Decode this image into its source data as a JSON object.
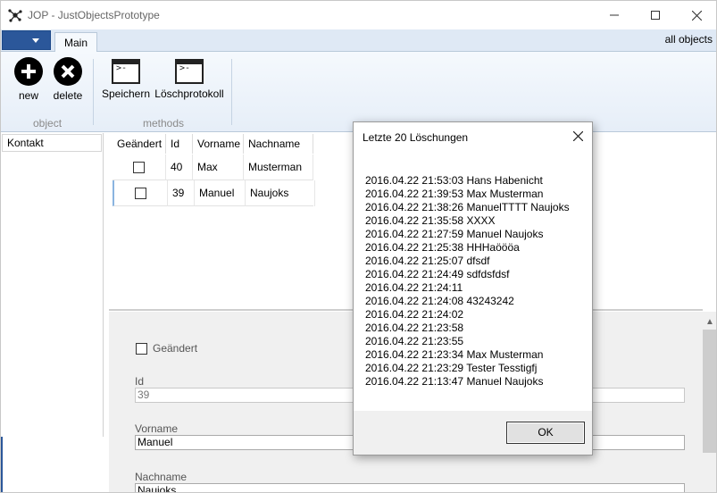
{
  "window": {
    "title": "JOP - JustObjectsPrototype"
  },
  "ribbon": {
    "tab_main": "Main",
    "all_objects": "all objects",
    "buttons": {
      "new": "new",
      "delete": "delete",
      "speichern": "Speichern",
      "loeschprotokoll": "Löschprotokoll"
    },
    "groups": {
      "object": "object",
      "methods": "methods"
    }
  },
  "nav": {
    "items": [
      {
        "label": "Kontakt"
      }
    ]
  },
  "grid": {
    "columns": [
      "Geändert",
      "Id",
      "Vorname",
      "Nachname"
    ],
    "rows": [
      {
        "changed": false,
        "id": "40",
        "vorname": "Max",
        "nachname": "Musterman"
      },
      {
        "changed": false,
        "id": "39",
        "vorname": "Manuel",
        "nachname": "Naujoks"
      }
    ]
  },
  "detail": {
    "changed_label": "Geändert",
    "id_label": "Id",
    "id_value": "39",
    "vorname_label": "Vorname",
    "vorname_value": "Manuel",
    "nachname_label": "Nachname",
    "nachname_value": "Naujoks"
  },
  "dialog": {
    "title": "Letzte 20 Löschungen",
    "ok": "OK",
    "entries": [
      "2016.04.22 21:53:03 Hans Habenicht",
      "2016.04.22 21:39:53 Max Musterman",
      "2016.04.22 21:38:26 ManuelTTTT Naujoks",
      "2016.04.22 21:35:58 XXXX",
      "2016.04.22 21:27:59 Manuel Naujoks",
      "2016.04.22 21:25:38 HHHaöööa",
      "2016.04.22 21:25:07 dfsdf",
      "2016.04.22 21:24:49 sdfdsfdsf",
      "2016.04.22 21:24:11",
      "2016.04.22 21:24:08 43243242",
      "2016.04.22 21:24:02",
      "2016.04.22 21:23:58",
      "2016.04.22 21:23:55",
      "2016.04.22 21:23:34 Max Musterman",
      "2016.04.22 21:23:29 Tester Tesstigfj",
      "2016.04.22 21:13:47 Manuel Naujoks"
    ]
  },
  "colors": {
    "accent": "#2b579a",
    "ribbon_bg": "#dfe9f5"
  },
  "icons": [
    "app-network-icon",
    "minimize-icon",
    "maximize-icon",
    "close-icon",
    "plus-icon",
    "x-icon",
    "terminal-icon"
  ]
}
